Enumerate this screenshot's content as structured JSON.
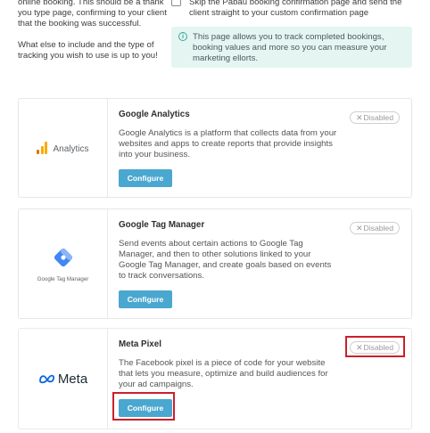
{
  "intro": {
    "paragraph1": "online booking. This should be a thank you type page, confirming to your client that the booking was successful.",
    "paragraph2": "What else to include and the type of tracking you wish to use is up to you!"
  },
  "skip_option": {
    "label": "Skip the Pabau booking confirmation page and send the client straight to your custom confirmation page",
    "checked": false
  },
  "info_box": {
    "icon": "info-circle-icon",
    "text": "This page allows you to track completed bookings, booking values and more so you can measure your marketing ellorts."
  },
  "integrations": [
    {
      "title": "Google Analytics",
      "logo_text": "Analytics",
      "logo_icon": "google-analytics-icon",
      "description": "Google Analytics is a platform that collects data from your websites and apps to create reports that provide insights into your business.",
      "button_label": "Configure",
      "status": "Disabled"
    },
    {
      "title": "Google Tag Manager",
      "logo_text": "Google Tag Manager",
      "logo_icon": "google-tag-manager-icon",
      "description": "Send events about certain actions to Google Tag Manager, and then to other solutions linked to your Google Tag Manager, and create goals based on events to track conversations.",
      "button_label": "Configure",
      "status": "Disabled"
    },
    {
      "title": "Meta Pixel",
      "logo_text": "Meta",
      "logo_icon": "meta-infinity-icon",
      "description": "The Facebook pixel is a piece of code for your website that lets you measure, optimize and build audiences for your ad campaigns.",
      "button_label": "Configure",
      "status": "Disabled"
    }
  ],
  "colors": {
    "button": "#4aa7cf",
    "info_bg": "#e4f5f2",
    "highlight": "#cc1f2d"
  }
}
